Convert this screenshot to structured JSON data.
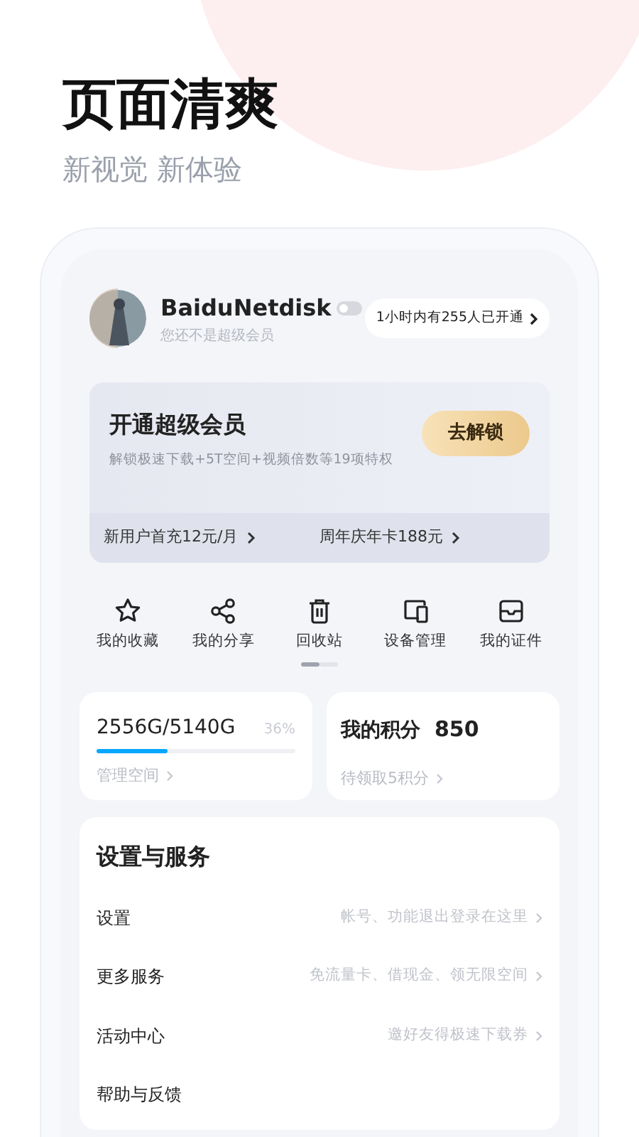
{
  "headline": {
    "title": "页面清爽",
    "subtitle": "新视觉 新体验"
  },
  "profile": {
    "name": "BaiduNetdisk",
    "status": "您还不是超级会员",
    "promo": "1小时内有255人已开通"
  },
  "vip_card": {
    "title": "开通超级会员",
    "description": "解锁极速下载+5T空间+视频倍数等19项特权",
    "button": "去解锁",
    "offers": [
      "新用户首充12元/月",
      "周年庆年卡188元"
    ]
  },
  "shortcuts": [
    {
      "kind": "star",
      "label": "我的收藏"
    },
    {
      "kind": "share",
      "label": "我的分享"
    },
    {
      "kind": "trash",
      "label": "回收站"
    },
    {
      "kind": "devices",
      "label": "设备管理"
    },
    {
      "kind": "card",
      "label": "我的证件"
    }
  ],
  "storage": {
    "usage": "2556G/5140G",
    "percent": "36%",
    "level": 0.36,
    "link": "管理空间"
  },
  "points": {
    "label": "我的积分",
    "value": "850",
    "link": "待领取5积分"
  },
  "services": {
    "title": "设置与服务",
    "rows": [
      {
        "label": "设置",
        "hint": "帐号、功能退出登录在这里"
      },
      {
        "label": "更多服务",
        "hint": "免流量卡、借现金、领无限空间"
      },
      {
        "label": "活动中心",
        "hint": "邀好友得极速下载券"
      },
      {
        "label": "帮助与反馈"
      }
    ]
  }
}
